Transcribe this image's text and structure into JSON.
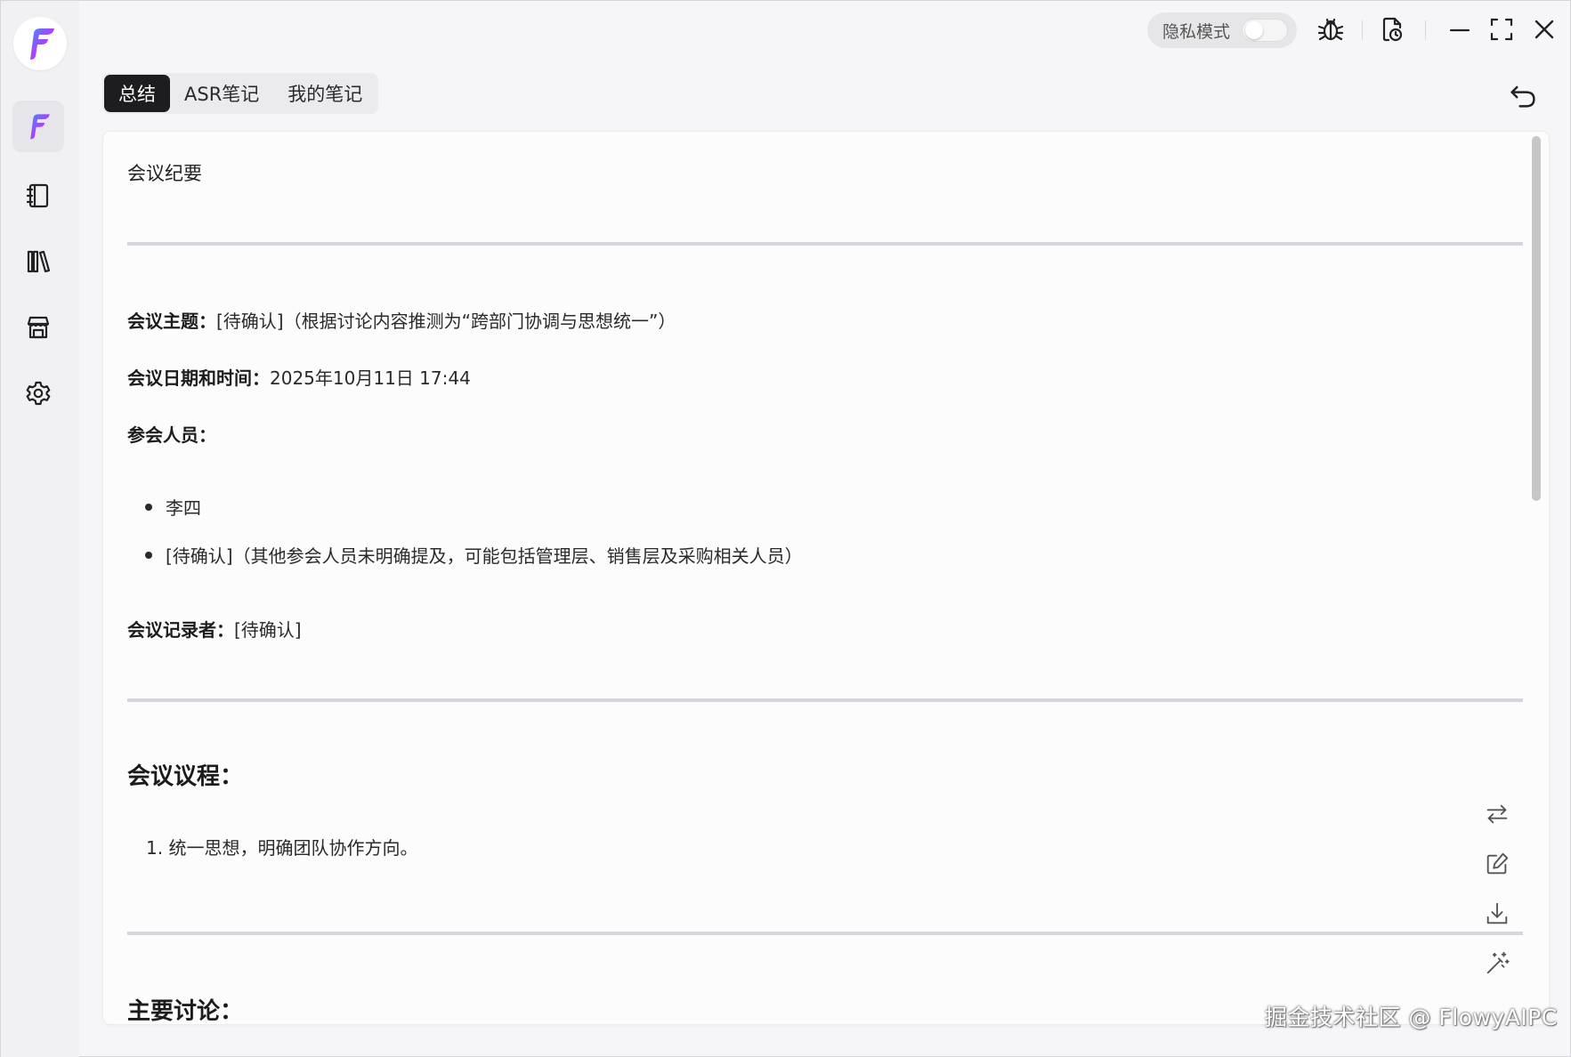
{
  "titlebar": {
    "privacy_label": "隐私模式",
    "privacy_on": false
  },
  "sidebar": {
    "items": [
      {
        "name": "brand-icon",
        "active": true
      },
      {
        "name": "notebook-icon"
      },
      {
        "name": "library-icon"
      },
      {
        "name": "store-icon"
      },
      {
        "name": "gear-icon"
      }
    ]
  },
  "tabs": [
    {
      "label": "总结",
      "active": true
    },
    {
      "label": "ASR笔记",
      "active": false
    },
    {
      "label": "我的笔记",
      "active": false
    }
  ],
  "doc": {
    "title": "会议纪要",
    "topic_label": "会议主题：",
    "topic_value": "[待确认]（根据讨论内容推测为“跨部门协调与思想统一”）",
    "date_label": "会议日期和时间：",
    "date_value": "2025年10月11日 17:44",
    "attendees_label": "参会人员：",
    "attendees": [
      "李四",
      "[待确认]（其他参会人员未明确提及，可能包括管理层、销售层及采购相关人员）"
    ],
    "recorder_label": "会议记录者：",
    "recorder_value": "[待确认]",
    "agenda_heading": "会议议程：",
    "agenda_items": [
      "1. 统一思想，明确团队协作方向。"
    ],
    "discussion_heading": "主要讨论："
  },
  "side_tools": [
    "swap-icon",
    "edit-icon",
    "download-icon",
    "magic-wand-icon"
  ],
  "watermark": "掘金技术社区 @ FlowyAIPC",
  "colors": {
    "accent_tab": "#1d1d1f",
    "divider": "#d5d7dc",
    "brand_gradient": [
      "#4f7cff",
      "#c43cff",
      "#ff4f8b"
    ]
  }
}
